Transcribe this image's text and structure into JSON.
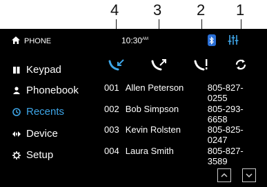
{
  "callouts": [
    "4",
    "3",
    "2",
    "1"
  ],
  "status": {
    "title": "PHONE",
    "time": "10:30",
    "ampm": "AM",
    "colors": {
      "bluetooth": "#2a6fd6",
      "accent": "#3ea6e8"
    }
  },
  "sidebar": {
    "items": [
      {
        "label": "Keypad",
        "icon": "keypad-icon",
        "active": false
      },
      {
        "label": "Phonebook",
        "icon": "person-icon",
        "active": false
      },
      {
        "label": "Recents",
        "icon": "recents-icon",
        "active": true
      },
      {
        "label": "Device",
        "icon": "device-icon",
        "active": false
      },
      {
        "label": "Setup",
        "icon": "gear-icon",
        "active": false
      }
    ]
  },
  "filters": [
    "incoming-call-icon",
    "outgoing-call-icon",
    "missed-call-icon",
    "refresh-icon"
  ],
  "recents": [
    {
      "num": "001",
      "name": "Allen Peterson",
      "phone": "805-827-0255"
    },
    {
      "num": "002",
      "name": "Bob Simpson",
      "phone": "805-293-6658"
    },
    {
      "num": "003",
      "name": "Kevin Rolsten",
      "phone": "805-825-0247"
    },
    {
      "num": "004",
      "name": "Laura Smith",
      "phone": "805-827-3589"
    }
  ]
}
